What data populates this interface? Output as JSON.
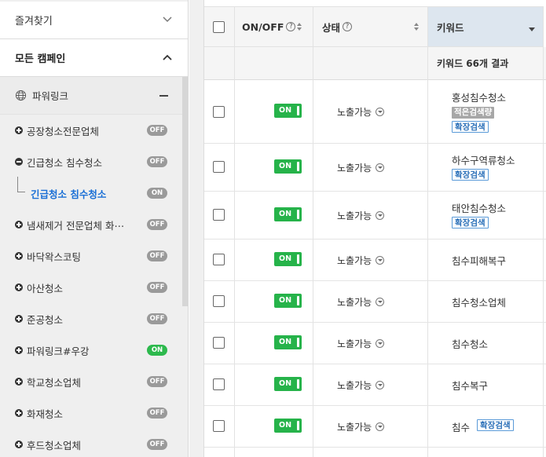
{
  "sidebar": {
    "favorites_label": "즐겨찾기",
    "all_campaigns_label": "모든 캠페인",
    "powerlink_label": "파워링크",
    "items": [
      {
        "label": "공장청소전문업체",
        "toggle": "OFF"
      },
      {
        "label": "긴급청소 침수청소",
        "toggle": "OFF"
      },
      {
        "label": "긴급청소 침수청소",
        "toggle": "ON"
      },
      {
        "label": "냄새제거 전문업체 화⋯",
        "toggle": "OFF"
      },
      {
        "label": "바닥왁스코팅",
        "toggle": "OFF"
      },
      {
        "label": "아산청소",
        "toggle": "OFF"
      },
      {
        "label": "준공청소",
        "toggle": "OFF"
      },
      {
        "label": "파워링크#우강",
        "toggle": "ON"
      },
      {
        "label": "학교청소업체",
        "toggle": "OFF"
      },
      {
        "label": "화재청소",
        "toggle": "OFF"
      },
      {
        "label": "후드청소업체",
        "toggle": "OFF"
      }
    ]
  },
  "table": {
    "headers": {
      "onoff": "ON/OFF",
      "status": "상태",
      "keyword": "키워드",
      "help_glyph": "?"
    },
    "result_text": "키워드 66개 결과",
    "rows": [
      {
        "toggle": "ON",
        "status": "노출가능",
        "keyword": "홍성침수청소",
        "badges": [
          "적은검색량",
          "확장검색"
        ]
      },
      {
        "toggle": "ON",
        "status": "노출가능",
        "keyword": "하수구역류청소",
        "badges": [
          "확장검색"
        ]
      },
      {
        "toggle": "ON",
        "status": "노출가능",
        "keyword": "태안침수청소",
        "badges": [
          "확장검색"
        ]
      },
      {
        "toggle": "ON",
        "status": "노출가능",
        "keyword": "침수피해복구",
        "badges": []
      },
      {
        "toggle": "ON",
        "status": "노출가능",
        "keyword": "침수청소업체",
        "badges": []
      },
      {
        "toggle": "ON",
        "status": "노출가능",
        "keyword": "침수청소",
        "badges": []
      },
      {
        "toggle": "ON",
        "status": "노출가능",
        "keyword": "침수복구",
        "badges": []
      },
      {
        "toggle": "ON",
        "status": "노출가능",
        "keyword": "침수",
        "badges": [
          "확장검색"
        ]
      }
    ]
  },
  "colors": {
    "toggle_on": "#2db94d",
    "toggle_off": "#9a9a9a",
    "on_button": "#26b34a",
    "sub_campaign": "#1a6fd6",
    "keyword_header": "#dde6ef"
  }
}
